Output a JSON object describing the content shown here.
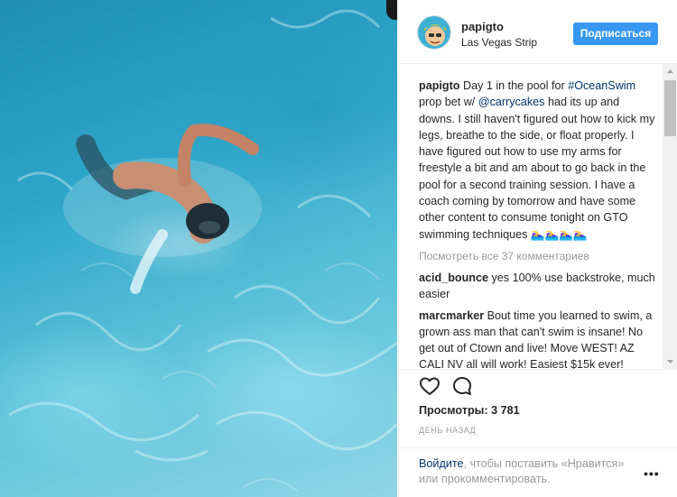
{
  "post": {
    "username": "papigto",
    "location": "Las Vegas Strip",
    "follow_label": "Подписаться",
    "caption_user": "papigto",
    "caption_pre": " Day 1 in the pool for ",
    "caption_hashtag": "#OceanSwim",
    "caption_mid": " prop bet w/ ",
    "caption_mention": "@carrycakes",
    "caption_post": " had its up and downs. I still haven't figured out how to kick my legs, breathe to the side, or float properly. I have figured out how to use my arms for freestyle a bit and am about to go back in the pool for a second training session. I have a coach coming by tomorrow and have some other content to consume tonight on GTO swimming techniques 🏊‍♀️🏊‍♀️🏊‍♀️🏊‍♀️",
    "view_all_comments": "Посмотреть все 37 комментариев",
    "comments": [
      {
        "user": "acid_bounce",
        "text": " yes 100% use backstroke, much easier"
      },
      {
        "user": "marcmarker",
        "text": " Bout time you learned to swim, a grown ass man that can't swim is insane! No get out of Ctown and live! Move WEST! AZ CALI NV all will work! Easiest $15k ever!"
      }
    ],
    "views_label": "Просмотры:",
    "views_count": " 3 781",
    "time_ago": "ДЕНЬ НАЗАД",
    "login_link": "Войдите",
    "login_rest": ", чтобы поставить «Нравится» или прокомментировать.",
    "more_label": "•••"
  },
  "icons": {
    "like": "heart-icon",
    "comment": "comment-bubble-icon",
    "more": "more-options-icon"
  },
  "colors": {
    "accent": "#3897f0",
    "link": "#003569",
    "muted": "#999999",
    "text": "#262626"
  }
}
